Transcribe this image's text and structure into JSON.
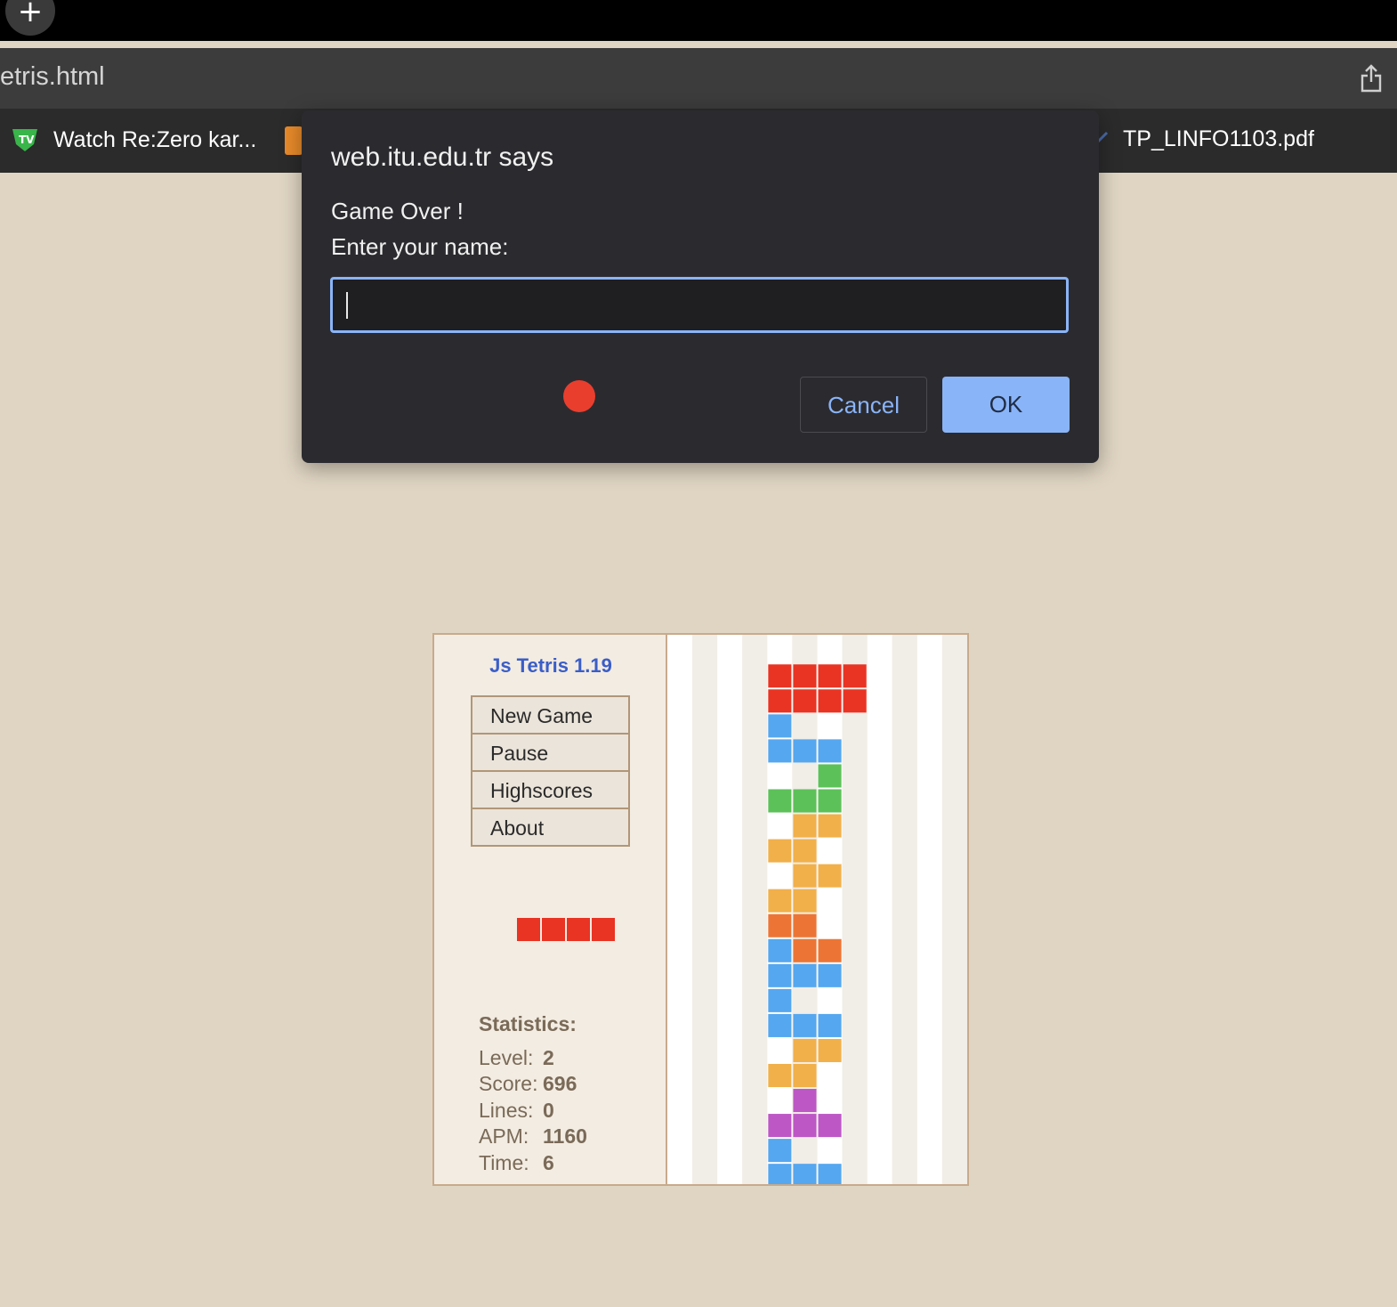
{
  "browser": {
    "url": "etris.html",
    "bookmarks": [
      "Watch Re:Zero kar...",
      "TP_LINFO1103.pdf"
    ]
  },
  "dialog": {
    "title": "web.itu.edu.tr says",
    "message_line1": "Game Over !",
    "message_line2": "Enter your name:",
    "input_value": "",
    "cancel_label": "Cancel",
    "ok_label": "OK"
  },
  "game": {
    "title": "Js Tetris 1.19",
    "menu": [
      "New Game",
      "Pause",
      "Highscores",
      "About"
    ],
    "stats_title": "Statistics:",
    "stats": [
      {
        "label": "Level:",
        "value": "2"
      },
      {
        "label": "Score:",
        "value": "696"
      },
      {
        "label": "Lines:",
        "value": "0"
      },
      {
        "label": "APM:",
        "value": "1160"
      },
      {
        "label": "Time:",
        "value": "6"
      }
    ],
    "colors": {
      "red": "#e93323",
      "blue": "#55a7ef",
      "green": "#5dc15a",
      "yellow": "#f1b04a",
      "orange": "#ec7535",
      "purple": "#bd57c6"
    },
    "next_piece": {
      "color": "red",
      "cells": 4
    },
    "board": {
      "cols": 12,
      "rows": 22,
      "cells": [
        [
          0,
          4,
          "red"
        ],
        [
          0,
          5,
          "red"
        ],
        [
          0,
          6,
          "red"
        ],
        [
          0,
          7,
          "red"
        ],
        [
          1,
          4,
          "red"
        ],
        [
          1,
          5,
          "red"
        ],
        [
          1,
          6,
          "red"
        ],
        [
          1,
          7,
          "red"
        ],
        [
          2,
          4,
          "blue"
        ],
        [
          3,
          4,
          "blue"
        ],
        [
          3,
          5,
          "blue"
        ],
        [
          3,
          6,
          "blue"
        ],
        [
          4,
          6,
          "green"
        ],
        [
          5,
          4,
          "green"
        ],
        [
          5,
          5,
          "green"
        ],
        [
          5,
          6,
          "green"
        ],
        [
          6,
          5,
          "yellow"
        ],
        [
          6,
          6,
          "yellow"
        ],
        [
          7,
          4,
          "yellow"
        ],
        [
          7,
          5,
          "yellow"
        ],
        [
          8,
          5,
          "yellow"
        ],
        [
          8,
          6,
          "yellow"
        ],
        [
          9,
          4,
          "yellow"
        ],
        [
          9,
          5,
          "yellow"
        ],
        [
          10,
          4,
          "orange"
        ],
        [
          10,
          5,
          "orange"
        ],
        [
          11,
          4,
          "blue"
        ],
        [
          11,
          5,
          "orange"
        ],
        [
          11,
          6,
          "orange"
        ],
        [
          12,
          4,
          "blue"
        ],
        [
          12,
          5,
          "blue"
        ],
        [
          12,
          6,
          "blue"
        ],
        [
          13,
          4,
          "blue"
        ],
        [
          14,
          4,
          "blue"
        ],
        [
          14,
          5,
          "blue"
        ],
        [
          14,
          6,
          "blue"
        ],
        [
          15,
          5,
          "yellow"
        ],
        [
          15,
          6,
          "yellow"
        ],
        [
          16,
          4,
          "yellow"
        ],
        [
          16,
          5,
          "yellow"
        ],
        [
          17,
          5,
          "purple"
        ],
        [
          18,
          4,
          "purple"
        ],
        [
          18,
          5,
          "purple"
        ],
        [
          18,
          6,
          "purple"
        ],
        [
          19,
          4,
          "blue"
        ],
        [
          20,
          4,
          "blue"
        ],
        [
          20,
          5,
          "blue"
        ],
        [
          20,
          6,
          "blue"
        ]
      ]
    }
  }
}
